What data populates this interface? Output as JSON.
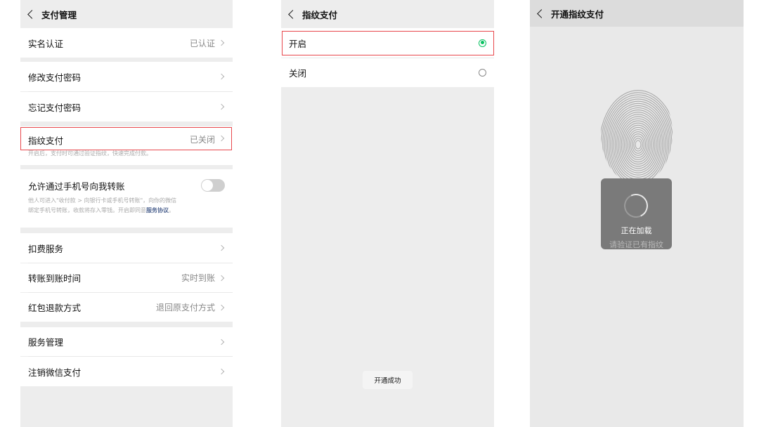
{
  "panel1": {
    "title": "支付管理",
    "rows": {
      "realname": {
        "label": "实名认证",
        "value": "已认证"
      },
      "change_pwd": {
        "label": "修改支付密码"
      },
      "forgot_pwd": {
        "label": "忘记支付密码"
      },
      "fingerprint": {
        "label": "指纹支付",
        "value": "已关闭",
        "desc": "开启后，支付时可通过验证指纹，快速完成付款。"
      },
      "phone_transfer": {
        "label": "允许通过手机号向我转账",
        "desc_line1": "他人可进入\"收付款 > 向银行卡或手机号转账\"，向你的微信",
        "desc_line2": "绑定手机号转账，收款将存入零钱。开启即同意",
        "desc_link": "服务协议",
        "desc_end": "。",
        "toggle_on": false
      },
      "deduction": {
        "label": "扣费服务"
      },
      "transfer_time": {
        "label": "转账到账时间",
        "value": "实时到账"
      },
      "refund": {
        "label": "红包退款方式",
        "value": "退回原支付方式"
      },
      "service_mgmt": {
        "label": "服务管理"
      },
      "cancel_pay": {
        "label": "注销微信支付"
      }
    }
  },
  "panel2": {
    "title": "指纹支付",
    "options": [
      {
        "label": "开启",
        "selected": true
      },
      {
        "label": "关闭",
        "selected": false
      }
    ],
    "toast": "开通成功",
    "accent": "#07c160"
  },
  "panel3": {
    "title": "开通指纹支付",
    "loading_text": "正在加载",
    "hint": "请验证已有指纹"
  },
  "colors": {
    "highlight_red": "#e8474c",
    "link_blue": "#576b95"
  },
  "icons": [
    "back-arrow-icon",
    "chevron-right-icon",
    "radio-selected-icon",
    "radio-unselected-icon",
    "fingerprint-icon",
    "loading-spinner-icon"
  ]
}
